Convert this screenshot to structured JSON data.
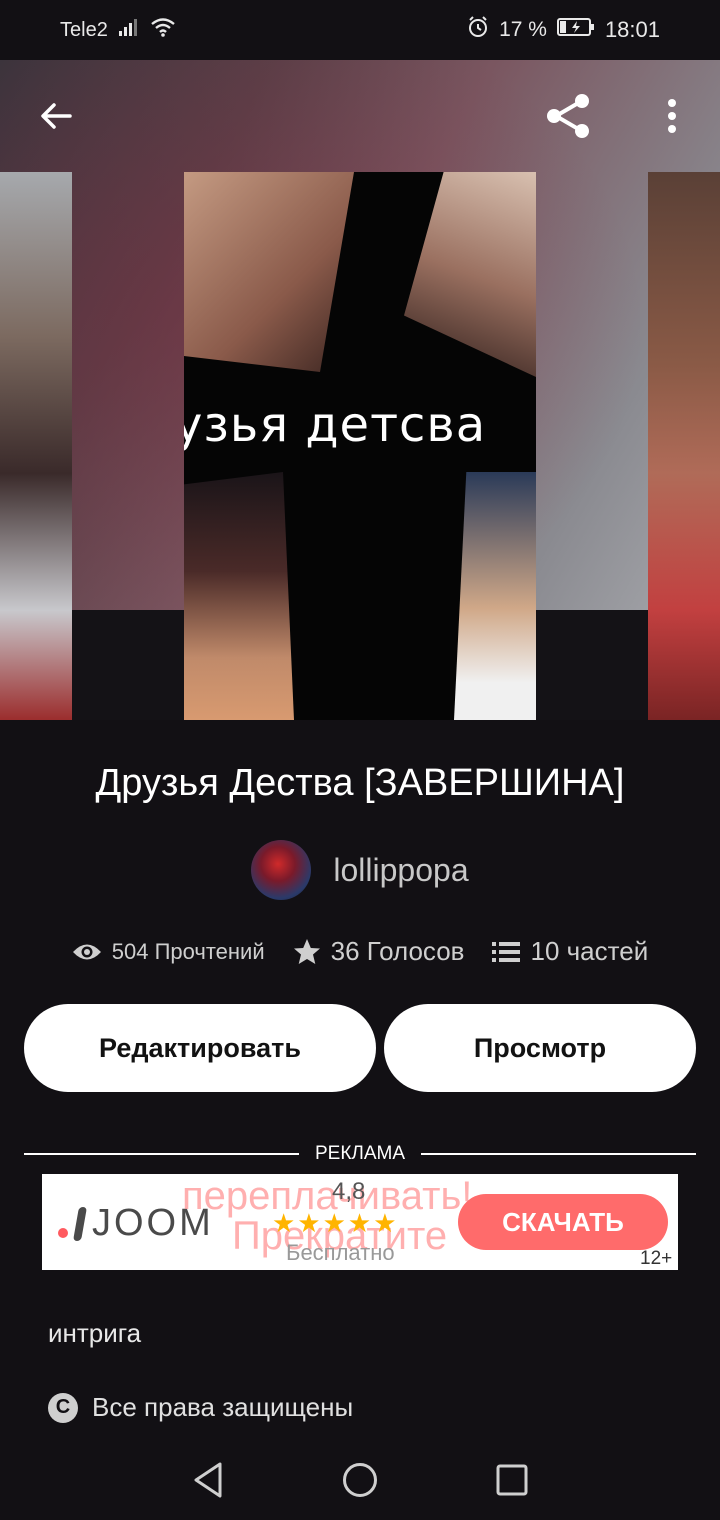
{
  "status_bar": {
    "carrier": "Tele2",
    "battery_percent": "17 %",
    "time": "18:01",
    "icons": [
      "signal-icon",
      "wifi-icon",
      "alarm-icon",
      "battery-charging-icon"
    ]
  },
  "header": {
    "back_icon": "arrow-left-icon",
    "share_icon": "share-icon",
    "more_icon": "more-vertical-icon"
  },
  "cover": {
    "text": "узья детсва"
  },
  "story": {
    "title": "Друзья Дества [ЗАВЕРШИНА]",
    "author": "lollippopa",
    "stats": {
      "reads": "504 Прочтений",
      "votes": "36 Голосов",
      "parts": "10 частей"
    }
  },
  "actions": {
    "edit_label": "Редактировать",
    "preview_label": "Просмотр"
  },
  "ad": {
    "label": "РЕКЛАМА",
    "brand": "JOOM",
    "overlay_line1": "переплачивать!",
    "overlay_line2": "Прекратите",
    "rating": "4,8",
    "stars": "★★★★★",
    "price": "Бесплатно",
    "cta": "СКАЧАТЬ",
    "age": "12+"
  },
  "tags": {
    "text": "интрига"
  },
  "rights": {
    "text": "Все права защищены"
  },
  "nav": {
    "icons": [
      "nav-back-icon",
      "nav-home-icon",
      "nav-recents-icon"
    ]
  }
}
